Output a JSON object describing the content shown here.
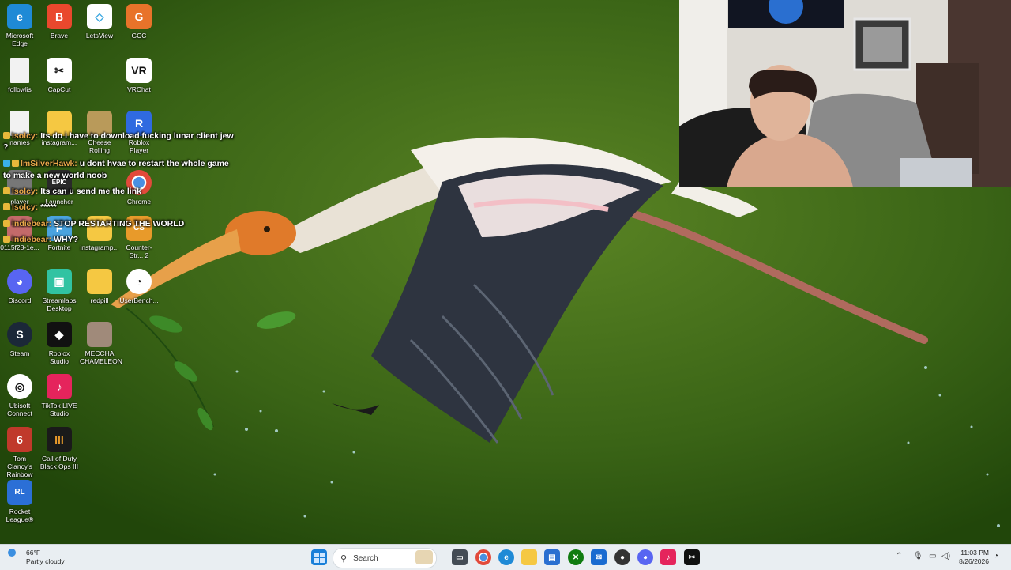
{
  "desktop": {
    "icons": [
      {
        "label": "Microsoft Edge",
        "glyph": "e",
        "color": "#1f8ad6"
      },
      {
        "label": "Brave",
        "glyph": "B",
        "color": "#e9482d"
      },
      {
        "label": "LetsView",
        "glyph": "◇",
        "color": "#3aa7e0"
      },
      {
        "label": "GCC",
        "glyph": "G",
        "color": "#e8732a"
      },
      {
        "label": "followlis",
        "glyph": "",
        "color": "#f2f2f2"
      },
      {
        "label": "CapCut",
        "glyph": "✂",
        "color": "#111111"
      },
      {
        "label": "VRChat",
        "glyph": "VR",
        "color": "#111111"
      },
      {
        "label": "names",
        "glyph": "",
        "color": "#f2f2f2"
      },
      {
        "label": "instagram...",
        "glyph": "",
        "color": "#f5c842"
      },
      {
        "label": "Cheese Rolling",
        "glyph": "",
        "color": "#b99a5a"
      },
      {
        "label": "Roblox Player",
        "glyph": "R",
        "color": "#2f6ae0"
      },
      {
        "label": "player",
        "glyph": "",
        "color": "#777777"
      },
      {
        "label": "Launcher",
        "glyph": "EPIC",
        "color": "#2a2a2a"
      },
      {
        "label": "Chrome",
        "glyph": "◉",
        "color": "#3b8d3d"
      },
      {
        "label": "0115f28-1e...",
        "glyph": "",
        "color": "#c36a6a"
      },
      {
        "label": "Fortnite",
        "glyph": "F",
        "color": "#4aa3df"
      },
      {
        "label": "instagramp...",
        "glyph": "",
        "color": "#f5c842"
      },
      {
        "label": "Counter-Str... 2",
        "glyph": "CS",
        "color": "#e89a2a"
      },
      {
        "label": "Discord",
        "glyph": "◕",
        "color": "#5865f2"
      },
      {
        "label": "Streamlabs Desktop",
        "glyph": "▣",
        "color": "#31c3a2"
      },
      {
        "label": "redpill",
        "glyph": "",
        "color": "#f5c842"
      },
      {
        "label": "UserBench...",
        "glyph": "◔",
        "color": "#ffffff"
      },
      {
        "label": "Steam",
        "glyph": "S",
        "color": "#1b2838"
      },
      {
        "label": "Roblox Studio",
        "glyph": "◆",
        "color": "#111111"
      },
      {
        "label": "MECCHA CHAMELEON",
        "glyph": "",
        "color": "#a08a7a"
      },
      {
        "label": "Ubisoft Connect",
        "glyph": "◎",
        "color": "#111111"
      },
      {
        "label": "TikTok LIVE Studio",
        "glyph": "♪",
        "color": "#e5245c"
      },
      {
        "label": "Tom Clancy's Rainbow Si...",
        "glyph": "6",
        "color": "#c0392b"
      },
      {
        "label": "Call of Duty Black Ops III",
        "glyph": "III",
        "color": "#1a1a1a"
      },
      {
        "label": "Rocket League®",
        "glyph": "RL",
        "color": "#2b6fd6"
      }
    ]
  },
  "chat": {
    "messages": [
      {
        "user": "Isolcy:",
        "text": "Its do i have to download fucking lunar client jew",
        "cont": "?"
      },
      {
        "user": "ImSilverHawk:",
        "text": "u dont hvae to restart the whole game",
        "cont": "to make a new world noob"
      },
      {
        "user": "Isolcy:",
        "text": "Its can u send me the link",
        "cont": ""
      },
      {
        "user": "Isolcy:",
        "text": "*****",
        "cont": ""
      },
      {
        "user": "indiebear:",
        "text": "STOP RESTARTING THE WORLD",
        "cont": ""
      },
      {
        "user": "indiebear:",
        "text": "WHY?",
        "cont": ""
      }
    ]
  },
  "taskbar": {
    "weather_temp": "66°F",
    "weather_desc": "Partly cloudy",
    "search_placeholder": "Search",
    "time": "11:03 PM",
    "date": "8/26/2026"
  },
  "colors": {
    "taskbar_bg": "#e9eef2",
    "chat_username": "#e8a84a"
  }
}
